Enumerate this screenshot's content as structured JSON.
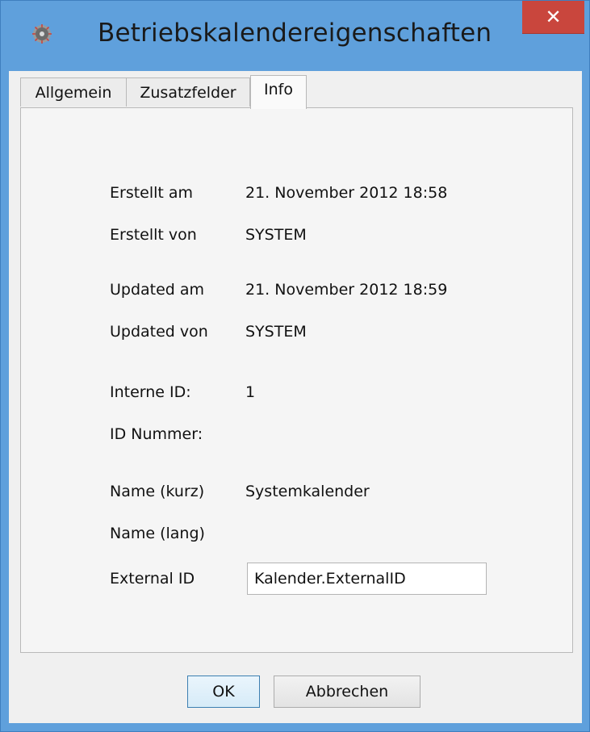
{
  "window": {
    "title": "Betriebskalendereigenschaften",
    "close_label": "✕"
  },
  "tabs": [
    {
      "label": "Allgemein",
      "active": false
    },
    {
      "label": "Zusatzfelder",
      "active": false
    },
    {
      "label": "Info",
      "active": true
    }
  ],
  "info": {
    "created_at": {
      "label": "Erstellt am",
      "value": "21. November 2012 18:58"
    },
    "created_by": {
      "label": "Erstellt von",
      "value": "SYSTEM"
    },
    "updated_at": {
      "label": "Updated am",
      "value": "21. November 2012 18:59"
    },
    "updated_by": {
      "label": "Updated von",
      "value": "SYSTEM"
    },
    "internal_id": {
      "label": "Interne ID:",
      "value": "1"
    },
    "id_number": {
      "label": "ID Nummer:",
      "value": ""
    },
    "name_short": {
      "label": "Name (kurz)",
      "value": "Systemkalender"
    },
    "name_long": {
      "label": "Name (lang)",
      "value": ""
    },
    "external_id": {
      "label": "External ID",
      "value": "Kalender.ExternalID"
    }
  },
  "buttons": {
    "ok": "OK",
    "cancel": "Abbrechen"
  },
  "colors": {
    "titlebar": "#5fa0dc",
    "close": "#c9463d",
    "client": "#f0f0f0"
  },
  "icons": {
    "app": "gear-icon",
    "close": "close-icon"
  }
}
